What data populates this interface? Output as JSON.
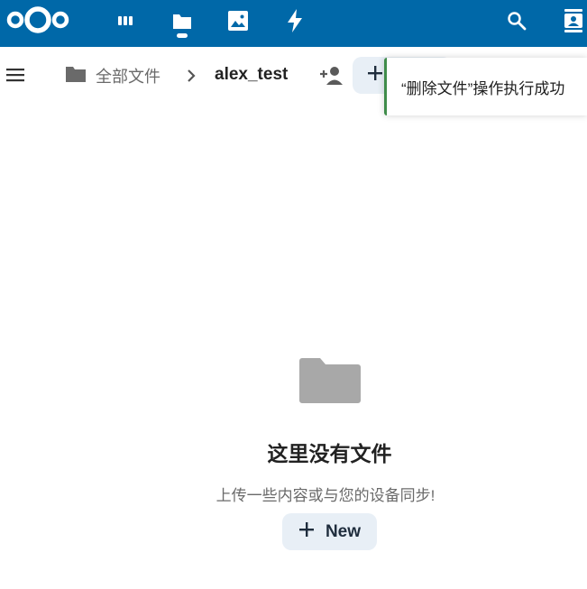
{
  "header": {
    "apps": [
      {
        "name": "dashboard",
        "icon": "dashboard-icon"
      },
      {
        "name": "files",
        "icon": "folder-icon",
        "active": true
      },
      {
        "name": "photos",
        "icon": "image-icon"
      },
      {
        "name": "activity",
        "icon": "lightning-icon"
      }
    ],
    "right_icons": [
      "search-icon",
      "contacts-icon"
    ],
    "bg_color": "#0068a8"
  },
  "breadcrumb": {
    "home_label": "全部文件",
    "current_label": "alex_test"
  },
  "new_button_top": {
    "icon": "plus-icon"
  },
  "toast": {
    "message": "“删除文件”操作执行成功",
    "accent_color": "#3f8c4a"
  },
  "empty_state": {
    "title": "这里没有文件",
    "subtitle": "上传一些内容或与您的设备同步!",
    "new_button_label": "New"
  }
}
